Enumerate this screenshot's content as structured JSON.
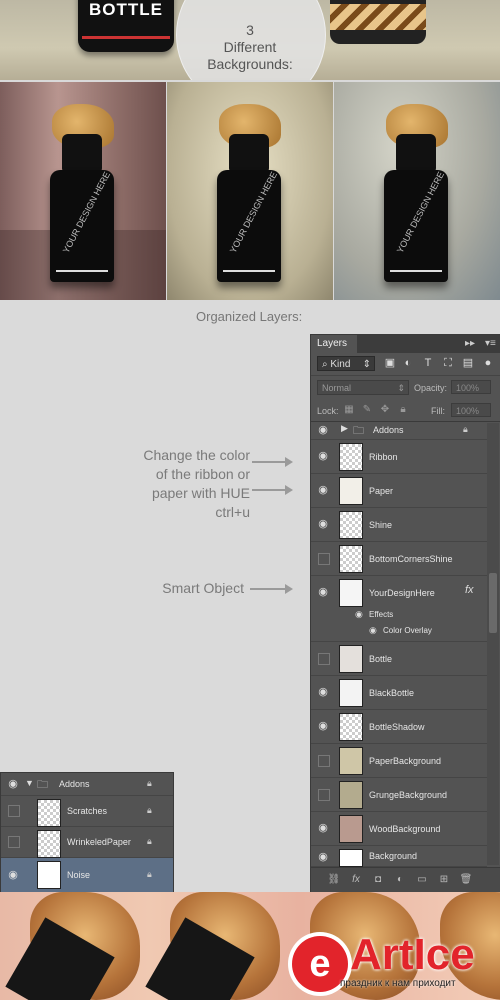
{
  "banner": {
    "bottle_label": "BOTTLE",
    "title": "3\nDifferent\nBackgrounds:"
  },
  "photos": [
    {
      "name": "wood",
      "text": "YOUR DESIGN HERE"
    },
    {
      "name": "paper",
      "text": "YOUR DESIGN HERE"
    },
    {
      "name": "grunge",
      "text": "YOUR DESIGN HERE"
    }
  ],
  "organized_title": "Organized Layers:",
  "annotations": {
    "ribbon": "Change the color\nof the ribbon or\npaper with HUE\nctrl+u",
    "smart_object": "Smart Object"
  },
  "layers_panel": {
    "tab": "Layers",
    "kind": "Kind",
    "blend_mode": "Normal",
    "opacity_label": "Opacity:",
    "opacity_value": "100%",
    "lock_label": "Lock:",
    "fill_label": "Fill:",
    "fill_value": "100%",
    "group_name": "Addons",
    "layers": [
      {
        "name": "Ribbon",
        "visible": true
      },
      {
        "name": "Paper",
        "visible": true
      },
      {
        "name": "Shine",
        "visible": true
      },
      {
        "name": "BottomCornersShine",
        "visible": false
      },
      {
        "name": "YourDesignHere",
        "visible": true
      },
      {
        "name": "Bottle",
        "visible": false
      },
      {
        "name": "BlackBottle",
        "visible": true
      },
      {
        "name": "BottleShadow",
        "visible": true
      },
      {
        "name": "PaperBackground",
        "visible": false
      },
      {
        "name": "GrungeBackground",
        "visible": false
      },
      {
        "name": "WoodBackground",
        "visible": true
      },
      {
        "name": "Background",
        "visible": true
      }
    ],
    "effects_label": "Effects",
    "color_overlay_label": "Color Overlay",
    "fx_label": "fx"
  },
  "addons_panel": {
    "group_name": "Addons",
    "layers": [
      {
        "name": "Scratches",
        "visible": false
      },
      {
        "name": "WrinkeledPaper",
        "visible": false
      },
      {
        "name": "Noise",
        "visible": true
      }
    ]
  },
  "logo": {
    "letter": "e",
    "name": "ArtIce",
    "tagline": "праздник к нам приходит"
  }
}
